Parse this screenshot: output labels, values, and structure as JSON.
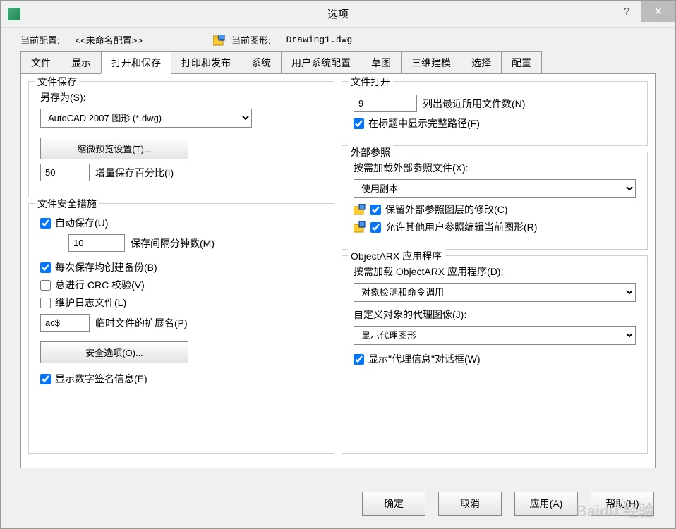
{
  "window": {
    "title": "选项"
  },
  "header": {
    "config_label": "当前配置:",
    "config_value": "<<未命名配置>>",
    "drawing_label": "当前图形:",
    "drawing_value": "Drawing1.dwg"
  },
  "tabs": [
    "文件",
    "显示",
    "打开和保存",
    "打印和发布",
    "系统",
    "用户系统配置",
    "草图",
    "三维建模",
    "选择",
    "配置"
  ],
  "active_tab": 2,
  "file_save": {
    "title": "文件保存",
    "save_as_label": "另存为(S):",
    "save_as_value": "AutoCAD 2007 图形 (*.dwg)",
    "thumb_btn": "缩微预览设置(T)...",
    "inc_value": "50",
    "inc_label": "增量保存百分比(I)"
  },
  "file_safety": {
    "title": "文件安全措施",
    "auto_save": "自动保存(U)",
    "interval_value": "10",
    "interval_label": "保存间隔分钟数(M)",
    "backup": "每次保存均创建备份(B)",
    "crc": "总进行 CRC 校验(V)",
    "logfile": "维护日志文件(L)",
    "temp_ext_value": "ac$",
    "temp_ext_label": "临时文件的扩展名(P)",
    "security_btn": "安全选项(O)...",
    "sig": "显示数字签名信息(E)"
  },
  "file_open": {
    "title": "文件打开",
    "recent_value": "9",
    "recent_label": "列出最近所用文件数(N)",
    "full_path": "在标题中显示完整路径(F)"
  },
  "xref": {
    "title": "外部参照",
    "load_label": "按需加载外部参照文件(X):",
    "load_value": "使用副本",
    "retain": "保留外部参照图层的修改(C)",
    "allow": "允许其他用户参照编辑当前图形(R)"
  },
  "arx": {
    "title": "ObjectARX 应用程序",
    "load_label": "按需加载 ObjectARX 应用程序(D):",
    "load_value": "对象检测和命令调用",
    "proxy_img_label": "自定义对象的代理图像(J):",
    "proxy_img_value": "显示代理图形",
    "show_proxy": "显示\"代理信息\"对话框(W)"
  },
  "footer": {
    "ok": "确定",
    "cancel": "取消",
    "apply": "应用(A)",
    "help": "帮助(H)"
  }
}
